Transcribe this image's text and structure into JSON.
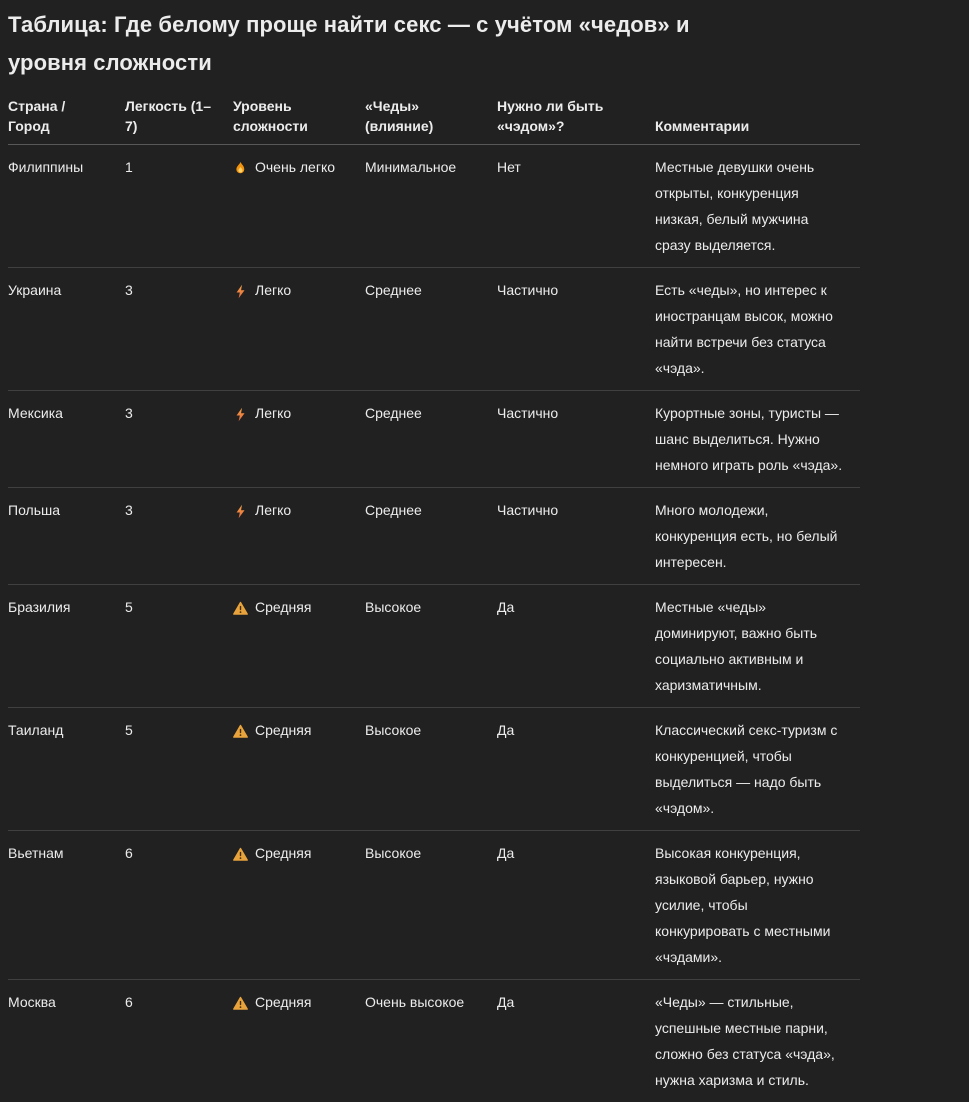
{
  "page": {
    "title": "Таблица: Где белому проще найти секс — с учётом «чедов» и уровня сложности"
  },
  "table": {
    "columns": [
      "Страна / Город",
      "Легкость (1–7)",
      "Уровень сложности",
      "«Чеды» (влияние)",
      "Нужно ли быть «чэдом»?",
      "Комментарии"
    ],
    "rows": [
      {
        "country": "Филиппины",
        "ease": "1",
        "difficulty_icon": "fire-icon",
        "difficulty": "Очень легко",
        "chads_influence": "Минимальное",
        "need_chad": "Нет",
        "comment": "Местные девушки очень открыты, конкуренция низкая, белый мужчина сразу выделяется."
      },
      {
        "country": "Украина",
        "ease": "3",
        "difficulty_icon": "lightning-icon",
        "difficulty": "Легко",
        "chads_influence": "Среднее",
        "need_chad": "Частично",
        "comment": "Есть «чеды», но интерес к иностранцам высок, можно найти встречи без статуса «чэда»."
      },
      {
        "country": "Мексика",
        "ease": "3",
        "difficulty_icon": "lightning-icon",
        "difficulty": "Легко",
        "chads_influence": "Среднее",
        "need_chad": "Частично",
        "comment": "Курортные зоны, туристы — шанс выделиться. Нужно немного играть роль «чэда»."
      },
      {
        "country": "Польша",
        "ease": "3",
        "difficulty_icon": "lightning-icon",
        "difficulty": "Легко",
        "chads_influence": "Среднее",
        "need_chad": "Частично",
        "comment": "Много молодежи, конкуренция есть, но белый интересен."
      },
      {
        "country": "Бразилия",
        "ease": "5",
        "difficulty_icon": "warning-icon",
        "difficulty": "Средняя",
        "chads_influence": "Высокое",
        "need_chad": "Да",
        "comment": "Местные «чеды» доминируют, важно быть социально активным и харизматичным."
      },
      {
        "country": "Таиланд",
        "ease": "5",
        "difficulty_icon": "warning-icon",
        "difficulty": "Средняя",
        "chads_influence": "Высокое",
        "need_chad": "Да",
        "comment": "Классический секс-туризм с конкуренцией, чтобы выделиться — надо быть «чэдом»."
      },
      {
        "country": "Вьетнам",
        "ease": "6",
        "difficulty_icon": "warning-icon",
        "difficulty": "Средняя",
        "chads_influence": "Высокое",
        "need_chad": "Да",
        "comment": "Высокая конкуренция, языковой барьер, нужно усилие, чтобы конкурировать с местными «чэдами»."
      },
      {
        "country": "Москва",
        "ease": "6",
        "difficulty_icon": "warning-icon",
        "difficulty": "Средняя",
        "chads_influence": "Очень высокое",
        "need_chad": "Да",
        "comment": "«Чеды» — стильные, успешные местные парни, сложно без статуса «чэда», нужна харизма и стиль."
      }
    ]
  },
  "colors": {
    "background": "#212121",
    "text": "#ececec",
    "row_border": "#404040",
    "header_border": "#585858",
    "fire_body": "#f2930d",
    "fire_core": "#ffd36b",
    "lightning": "#e8673a",
    "lightning_top": "#f5a54a",
    "warning_triangle": "#e8a33d",
    "warning_mark": "#402d00"
  }
}
